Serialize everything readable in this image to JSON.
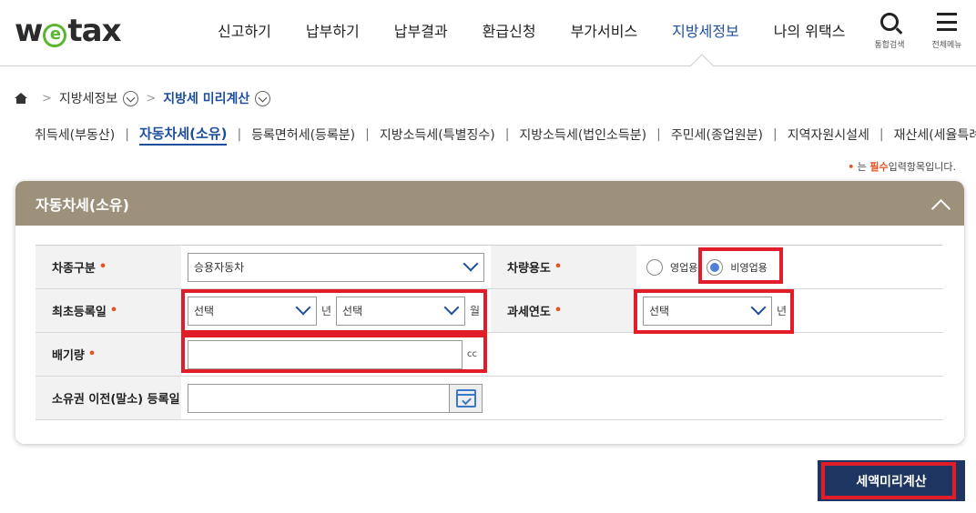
{
  "header": {
    "logo_text_1": "w",
    "logo_text_e": "e",
    "logo_text_2": "tax",
    "nav": [
      "신고하기",
      "납부하기",
      "납부결과",
      "환급신청",
      "부가서비스",
      "지방세정보",
      "나의 위택스"
    ],
    "active_nav": "지방세정보",
    "search_label": "통합검색",
    "menu_label": "전체메뉴"
  },
  "breadcrumb": {
    "level1": "지방세정보",
    "current": "지방세 미리계산"
  },
  "tabs": [
    "취득세(부동산)",
    "자동차세(소유)",
    "등록면허세(등록분)",
    "지방소득세(특별징수)",
    "지방소득세(법인소득분)",
    "주민세(종업원분)",
    "지역자원시설세",
    "재산세(세율특례)"
  ],
  "active_tab": "자동차세(소유)",
  "required_note": {
    "dot": "•",
    "prefix": "는",
    "must": "필수",
    "suffix": "입력항목입니다."
  },
  "panel": {
    "title": "자동차세(소유)",
    "fields": {
      "car_type": {
        "label": "차종구분",
        "req": "•",
        "value": "승용자동차"
      },
      "car_use": {
        "label": "차량용도",
        "req": "•",
        "options": [
          "영업용",
          "비영업용"
        ],
        "selected": "비영업용"
      },
      "first_reg": {
        "label": "최초등록일",
        "req": "•",
        "year_value": "선택",
        "year_unit": "년",
        "month_value": "선택",
        "month_unit": "월"
      },
      "tax_year": {
        "label": "과세연도",
        "req": "•",
        "value": "선택",
        "unit": "년"
      },
      "displacement": {
        "label": "배기량",
        "req": "•",
        "value": "",
        "unit": "cc"
      },
      "transfer_date": {
        "label": "소유권 이전(말소) 등록일",
        "value": ""
      }
    }
  },
  "calc_button": "세액미리계산",
  "colors": {
    "accent": "#1d4f9c",
    "panel_header": "#9e917c",
    "highlight": "#e21d2a",
    "button": "#1f3561",
    "required": "#e8501f"
  }
}
